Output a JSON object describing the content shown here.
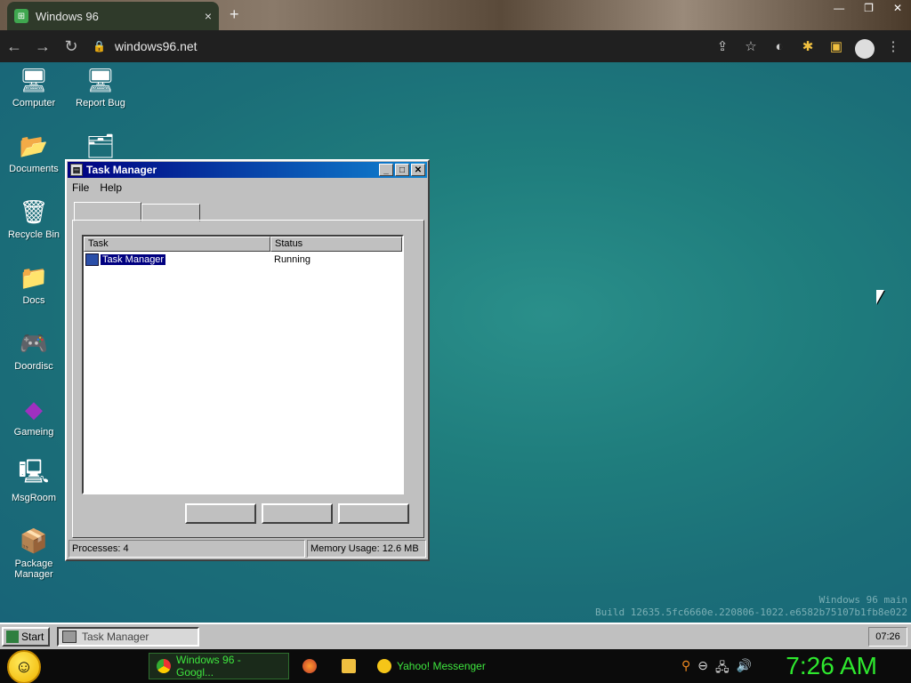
{
  "browser": {
    "tab_title": "Windows 96",
    "tab_close": "×",
    "new_tab": "+",
    "url": "windows96.net",
    "window_controls": [
      "—",
      "❐",
      "✕"
    ]
  },
  "desktop_icons": [
    {
      "name": "computer",
      "label": "Computer",
      "glyph": "🖥"
    },
    {
      "name": "report-bug",
      "label": "Report Bug",
      "glyph": "🖥"
    },
    {
      "name": "documents",
      "label": "Documents",
      "glyph": "📂"
    },
    {
      "name": "folder-tools",
      "label": "",
      "glyph": "🗂"
    },
    {
      "name": "recycle-bin",
      "label": "Recycle Bin",
      "glyph": "🗑"
    },
    {
      "name": "docs",
      "label": "Docs",
      "glyph": "📁"
    },
    {
      "name": "doordisc",
      "label": "Doordisc",
      "glyph": "🎮"
    },
    {
      "name": "gameing",
      "label": "Gameing",
      "glyph": "◆"
    },
    {
      "name": "msgroom",
      "label": "MsgRoom",
      "glyph": "🖳"
    },
    {
      "name": "package-manager",
      "label": "Package Manager",
      "glyph": "📦"
    }
  ],
  "build_info": {
    "line1": "Windows 96 main",
    "line2": "Build 12635.5fc6660e.220806-1022.e6582b75107b1fb8e022"
  },
  "task_manager": {
    "title": "Task Manager",
    "menu": [
      "File",
      "Help"
    ],
    "columns": [
      "Task",
      "Status"
    ],
    "rows": [
      {
        "task": "Task Manager",
        "status": "Running"
      }
    ],
    "status_processes": "Processes: 4",
    "status_memory": "Memory Usage: 12.6 MB"
  },
  "w96_taskbar": {
    "start": "Start",
    "task": "Task Manager",
    "clock": "07:26"
  },
  "host_taskbar": {
    "chrome_btn": "Windows 96 - Googl...",
    "yahoo_btn": "Yahoo! Messenger",
    "clock": "7:26 AM"
  }
}
